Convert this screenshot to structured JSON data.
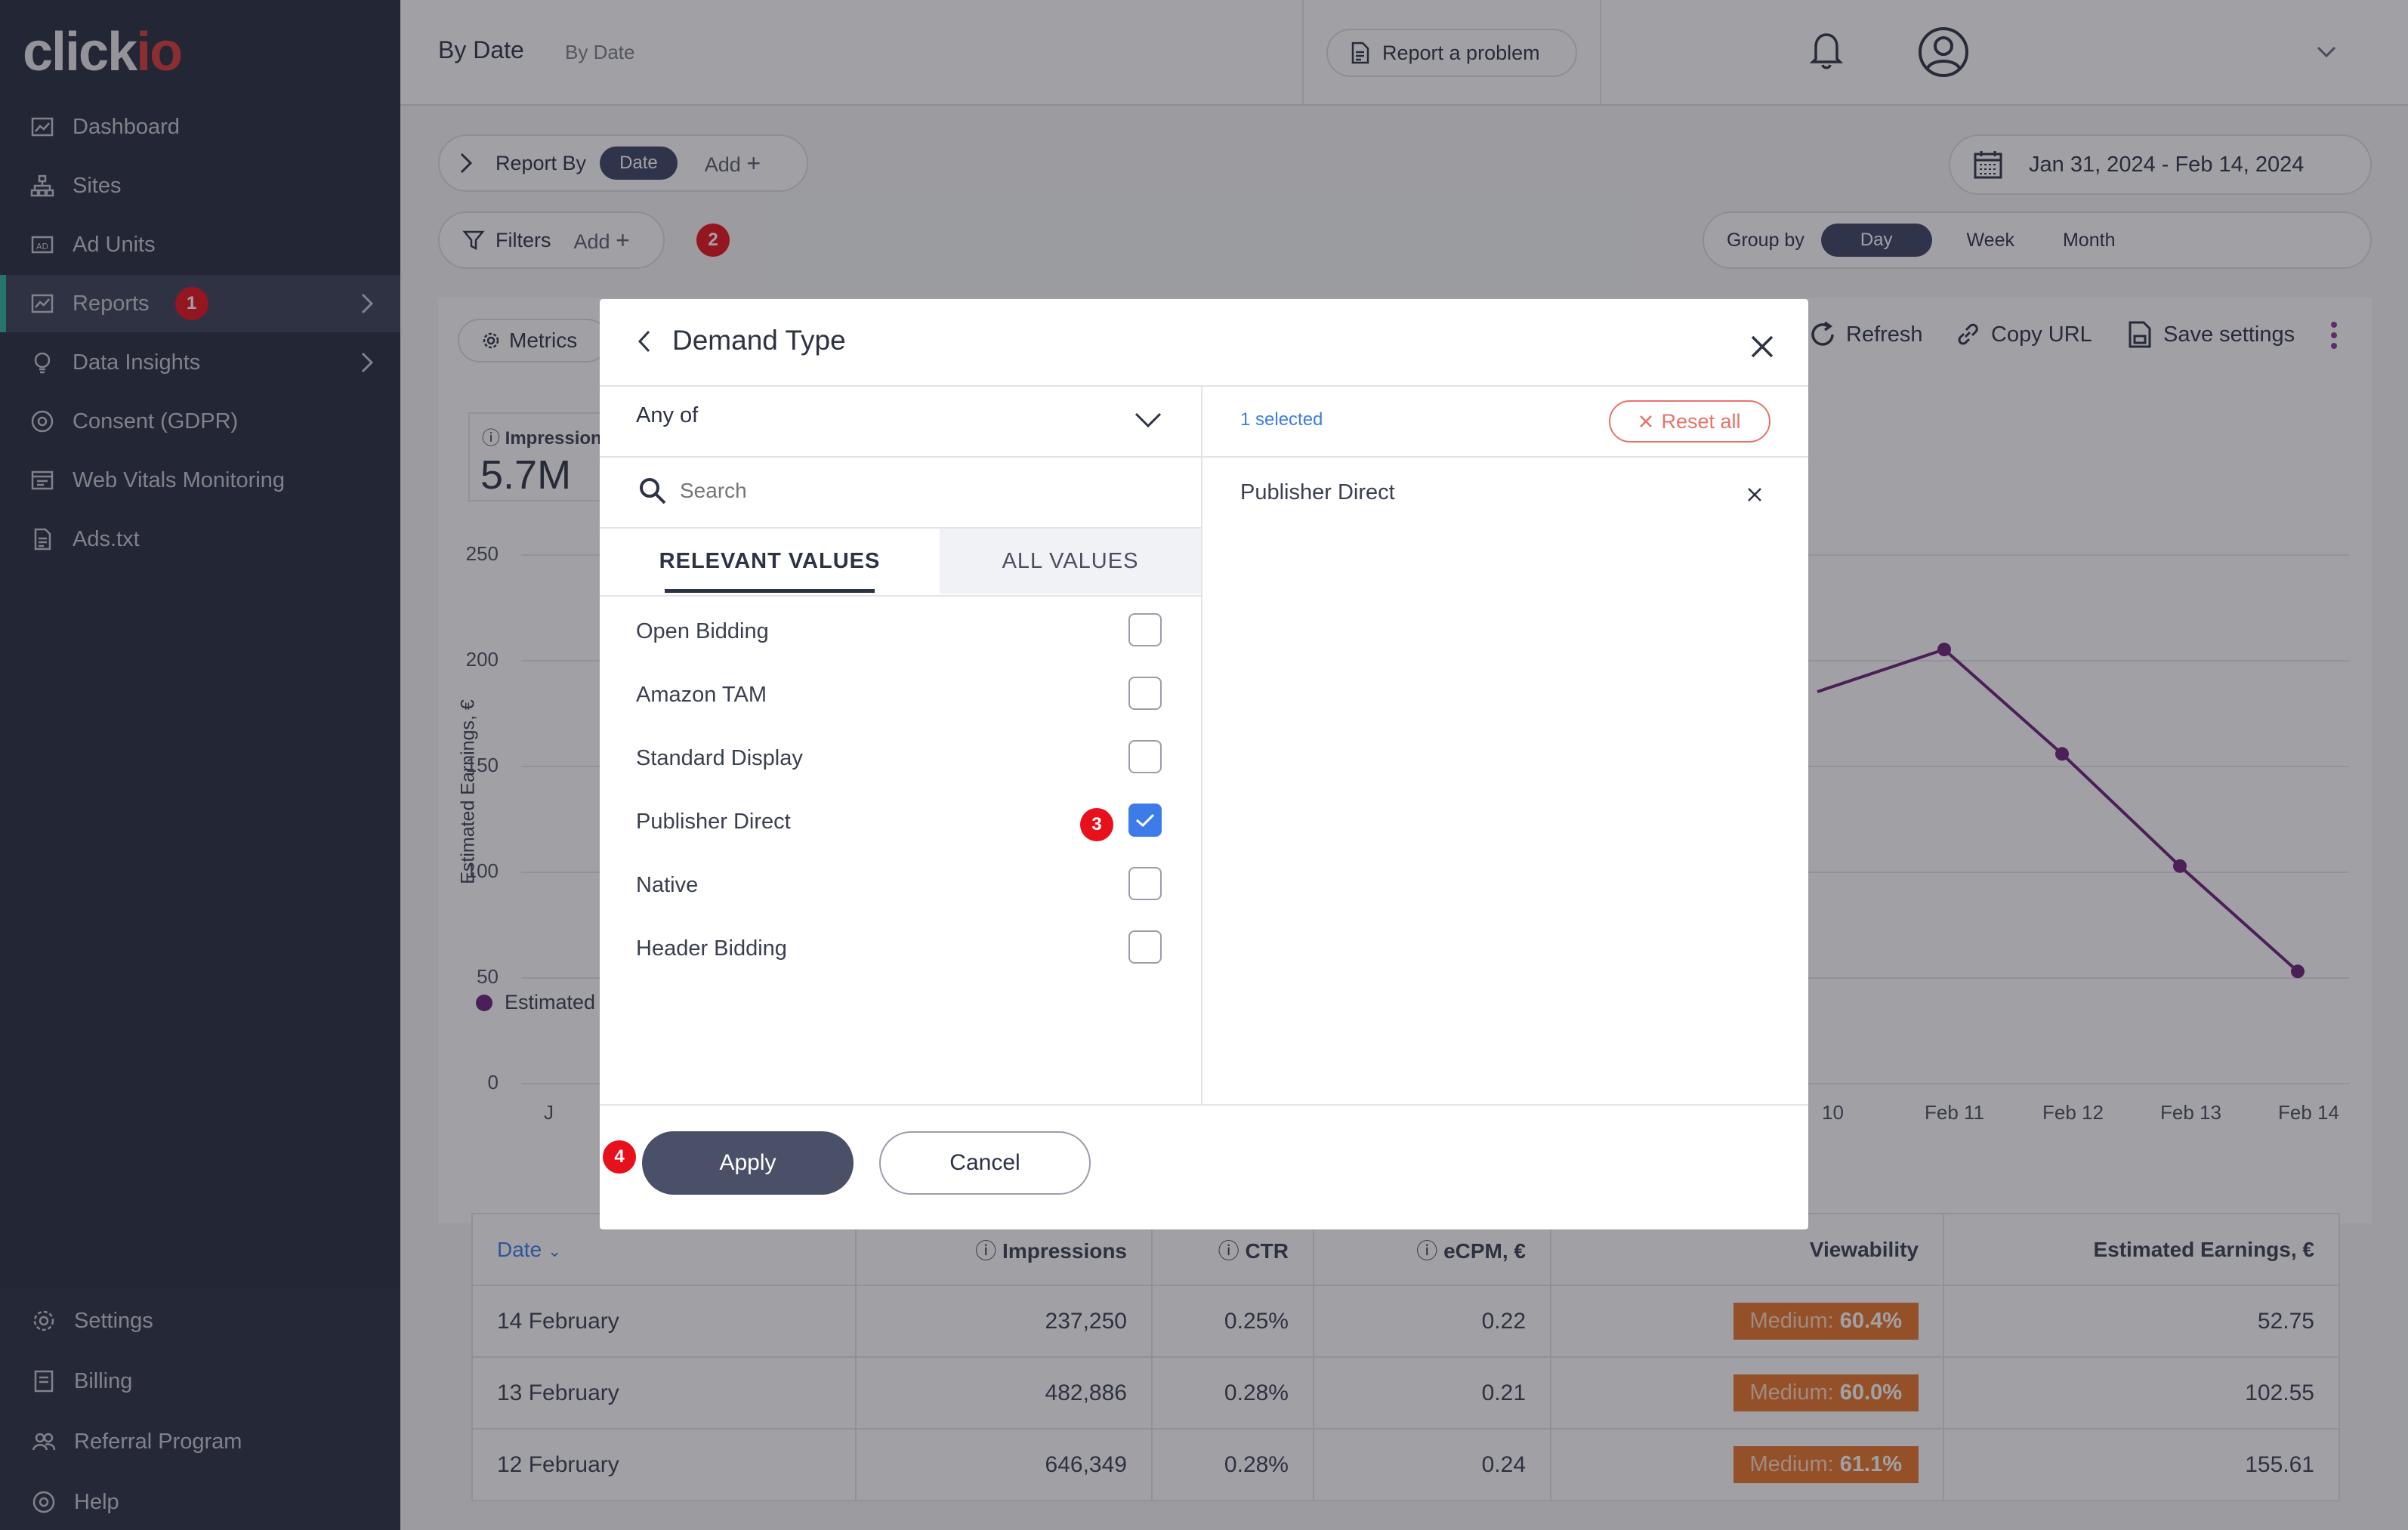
{
  "brand": {
    "logo_main": "click",
    "logo_accent": "io"
  },
  "sidebar": {
    "items": [
      {
        "label": "Dashboard",
        "icon": "dashboard-icon"
      },
      {
        "label": "Sites",
        "icon": "sitemap-icon"
      },
      {
        "label": "Ad Units",
        "icon": "ad-units-icon"
      },
      {
        "label": "Reports",
        "icon": "reports-icon",
        "badge": "1"
      },
      {
        "label": "Data Insights",
        "icon": "lightbulb-icon"
      },
      {
        "label": "Consent (GDPR)",
        "icon": "consent-icon"
      },
      {
        "label": "Web Vitals Monitoring",
        "icon": "web-vitals-icon"
      },
      {
        "label": "Ads.txt",
        "icon": "file-icon"
      }
    ],
    "bottom_items": [
      {
        "label": "Settings",
        "icon": "gear-icon"
      },
      {
        "label": "Billing",
        "icon": "billing-icon"
      },
      {
        "label": "Referral Program",
        "icon": "referral-icon"
      },
      {
        "label": "Help",
        "icon": "help-icon"
      }
    ]
  },
  "header": {
    "title": "By Date",
    "breadcrumb": "By Date",
    "report_problem": "Report a problem"
  },
  "toolbar": {
    "report_by_label": "Report By",
    "report_by_chip": "Date",
    "add_label": "Add",
    "date_range": "Jan 31, 2024 - Feb 14, 2024",
    "filters_label": "Filters",
    "filters_add": "Add",
    "filters_badge": "2",
    "group_by_label": "Group by",
    "group_by_options": [
      "Day",
      "Week",
      "Month"
    ],
    "metrics_label": "Metrics",
    "refresh_label": "Refresh",
    "copy_url_label": "Copy URL",
    "save_settings_label": "Save settings"
  },
  "kpi": {
    "label": "Impressions",
    "value": "5.7M"
  },
  "chart_data": {
    "type": "line",
    "ylabel": "Estimated Earnings, €",
    "yticks": [
      "250",
      "200",
      "150",
      "100",
      "50",
      "0"
    ],
    "ylim": [
      0,
      250
    ],
    "x_visible": [
      "Feb 10",
      "Feb 11",
      "Feb 12",
      "Feb 13",
      "Feb 14"
    ],
    "xtick_labels": [
      "J",
      "10",
      "Feb 11",
      "Feb 12",
      "Feb 13",
      "Feb 14"
    ],
    "series": [
      {
        "name": "Estimated Earnings",
        "legend_label": "Estimated",
        "color": "#6b1f7a",
        "x": [
          "Feb 10",
          "Feb 11",
          "Feb 12",
          "Feb 13",
          "Feb 14"
        ],
        "values": [
          185,
          205,
          155.61,
          102.55,
          52.75
        ]
      }
    ]
  },
  "table": {
    "columns": [
      "Date",
      "Impressions",
      "CTR",
      "eCPM, €",
      "Viewability",
      "Estimated Earnings, €"
    ],
    "rows": [
      {
        "date": "14 February",
        "impressions": "237,250",
        "ctr": "0.25%",
        "ecpm": "0.22",
        "view_label": "Medium:",
        "view_value": "60.4%",
        "earnings": "52.75"
      },
      {
        "date": "13 February",
        "impressions": "482,886",
        "ctr": "0.28%",
        "ecpm": "0.21",
        "view_label": "Medium:",
        "view_value": "60.0%",
        "earnings": "102.55"
      },
      {
        "date": "12 February",
        "impressions": "646,349",
        "ctr": "0.28%",
        "ecpm": "0.24",
        "view_label": "Medium:",
        "view_value": "61.1%",
        "earnings": "155.61"
      }
    ]
  },
  "modal": {
    "title": "Demand Type",
    "match_mode": "Any of",
    "search_placeholder": "Search",
    "tabs": [
      "RELEVANT VALUES",
      "ALL VALUES"
    ],
    "options": [
      {
        "label": "Open Bidding",
        "checked": false
      },
      {
        "label": "Amazon TAM",
        "checked": false
      },
      {
        "label": "Standard Display",
        "checked": false
      },
      {
        "label": "Publisher Direct",
        "checked": true
      },
      {
        "label": "Native",
        "checked": false
      },
      {
        "label": "Header Bidding",
        "checked": false
      }
    ],
    "selected_count": "1 selected",
    "reset_all": "Reset all",
    "selected_items": [
      "Publisher Direct"
    ],
    "apply": "Apply",
    "cancel": "Cancel",
    "step_badges": [
      "3",
      "4"
    ]
  },
  "colors": {
    "accent_teal": "#2bb39a",
    "badge_red": "#e8101b",
    "chart_line": "#6b1f7a",
    "checkbox_blue": "#3d7ce8",
    "viewability_orange": "#e8752a"
  }
}
